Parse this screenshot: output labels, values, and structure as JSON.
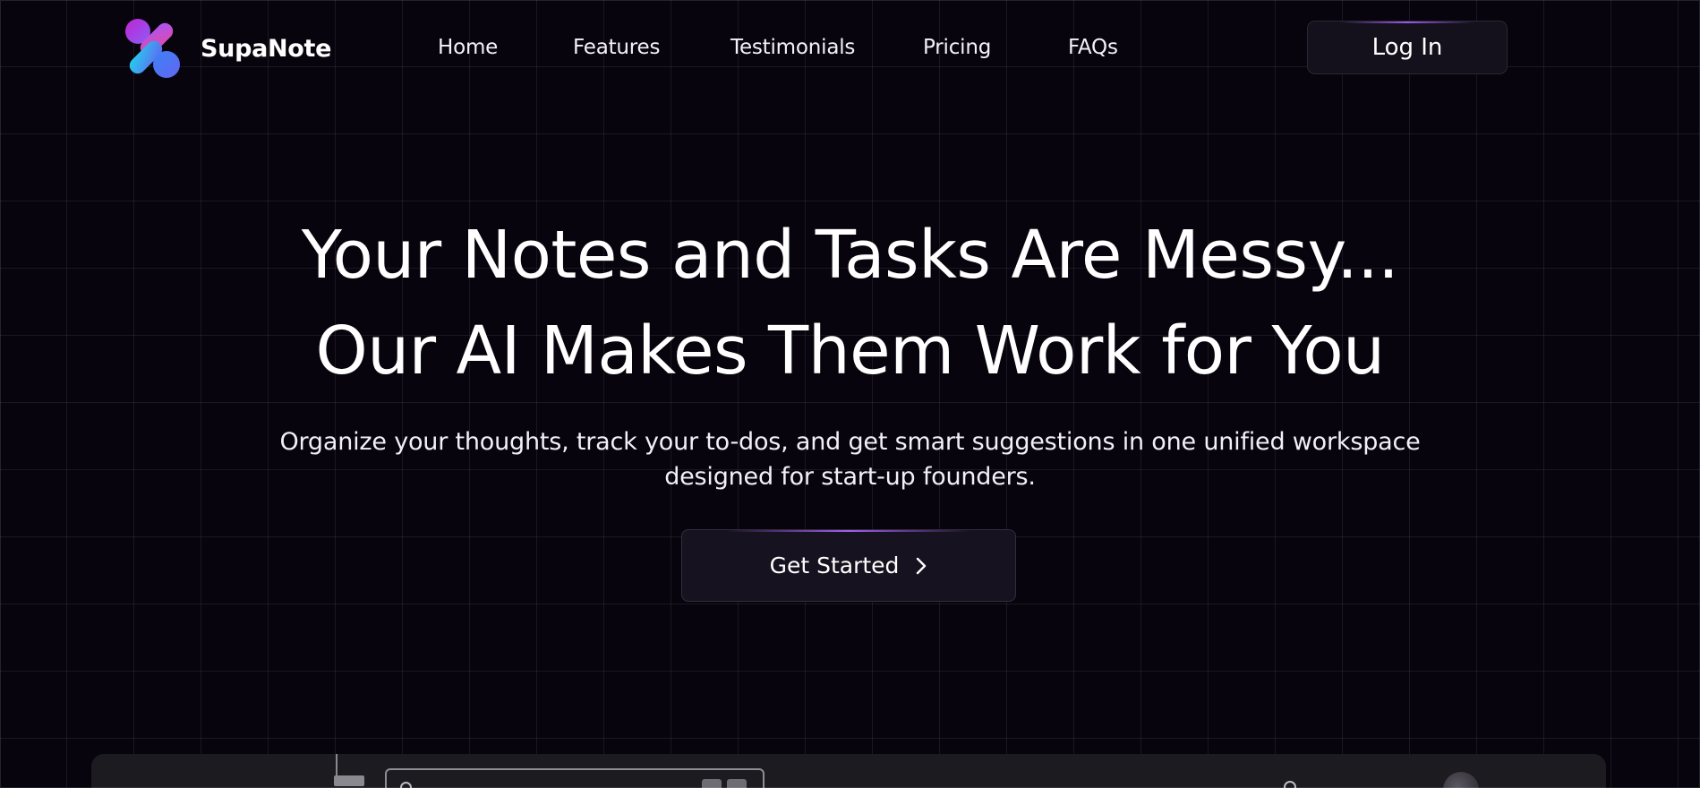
{
  "brand": {
    "name": "SupaNote",
    "logo_icon": "supanote-logo-icon",
    "colors": {
      "magenta": "#e14de6",
      "purple": "#8b5cf6",
      "blue": "#3b82f6",
      "cyan": "#22d3ee"
    }
  },
  "nav": {
    "links": [
      {
        "label": "Home"
      },
      {
        "label": "Features"
      },
      {
        "label": "Testimonials"
      },
      {
        "label": "Pricing"
      },
      {
        "label": "FAQs"
      }
    ],
    "login_label": "Log In"
  },
  "hero": {
    "title_line1": "Your Notes and Tasks Are Messy...",
    "title_line2": "Our AI Makes Them Work for You",
    "subtitle": "Organize your thoughts, track your to-dos, and get smart suggestions in one unified workspace designed for start-up founders.",
    "cta_label": "Get Started",
    "cta_icon": "chevron-right-icon"
  },
  "theme": {
    "background": "#07040d",
    "accent": "#9a5ae8"
  }
}
